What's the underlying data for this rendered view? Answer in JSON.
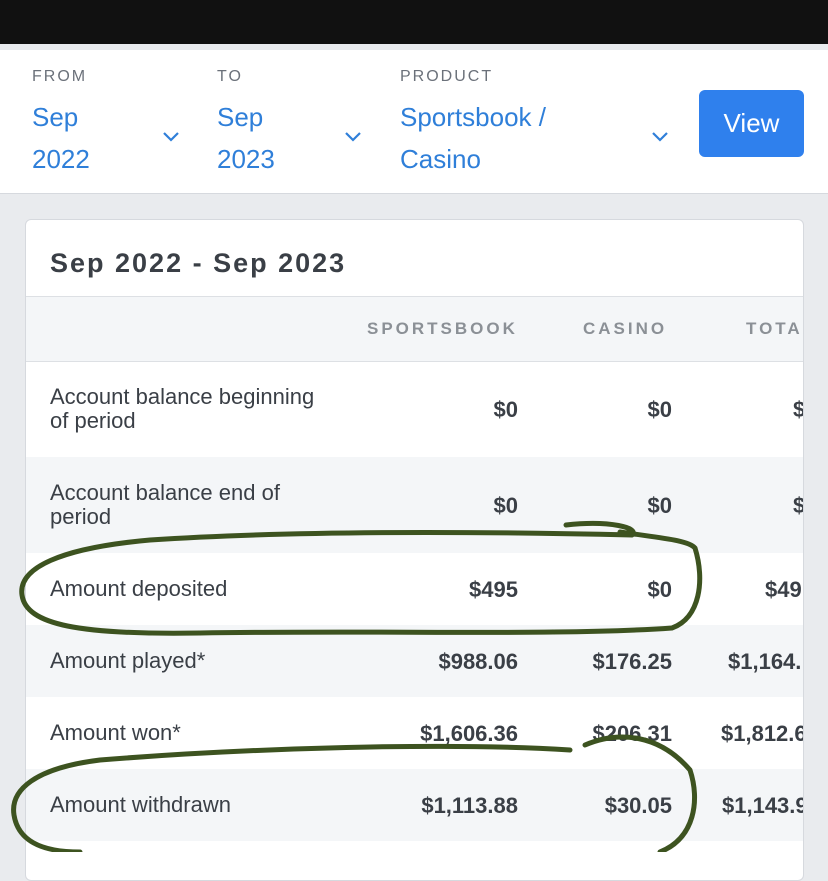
{
  "filters": {
    "from": {
      "label": "FROM",
      "value": "Sep\n2022"
    },
    "to": {
      "label": "TO",
      "value": "Sep\n2023"
    },
    "product": {
      "label": "PRODUCT",
      "value": "Sportsbook /\nCasino"
    },
    "view_label": "View"
  },
  "statement": {
    "title": "Sep 2022 - Sep 2023",
    "columns": [
      "SPORTSBOOK",
      "CASINO",
      "TOTA"
    ],
    "rows": [
      {
        "label": "Account balance beginning of period",
        "sportsbook": "$0",
        "casino": "$0",
        "total": "$"
      },
      {
        "label": "Account balance end of period",
        "sportsbook": "$0",
        "casino": "$0",
        "total": "$"
      },
      {
        "label": "Amount deposited",
        "sportsbook": "$495",
        "casino": "$0",
        "total": "$49"
      },
      {
        "label": "Amount played*",
        "sportsbook": "$988.06",
        "casino": "$176.25",
        "total": "$1,164.:"
      },
      {
        "label": "Amount won*",
        "sportsbook": "$1,606.36",
        "casino": "$206.31",
        "total": "$1,812.6"
      },
      {
        "label": "Amount withdrawn",
        "sportsbook": "$1,113.88",
        "casino": "$30.05",
        "total": "$1,143.9"
      }
    ]
  },
  "colors": {
    "accent": "#2f80ed",
    "link": "#2f7fd9",
    "annotation": "#3d5320"
  }
}
